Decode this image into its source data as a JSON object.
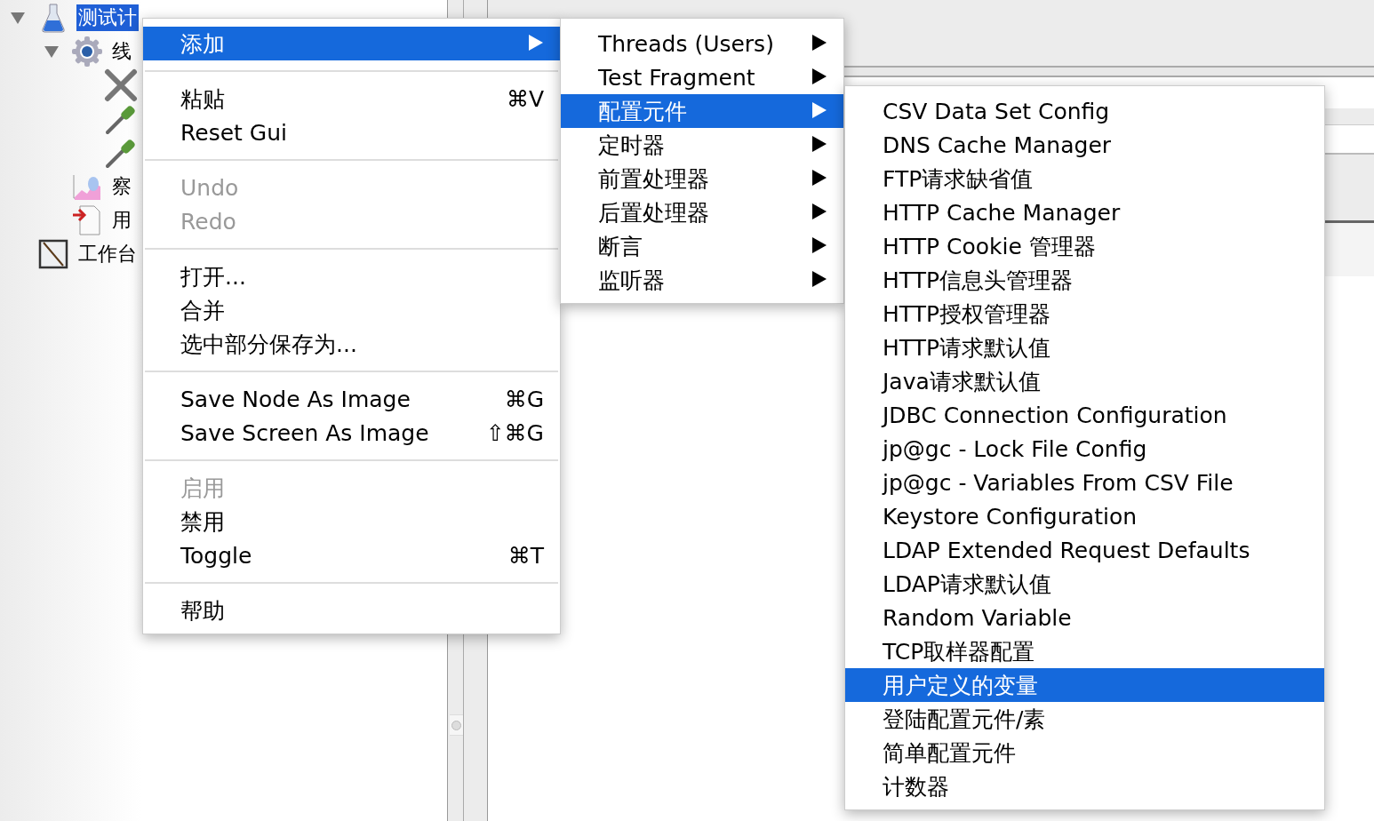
{
  "tree": [
    {
      "label": "测试计",
      "kind": "plan",
      "selected": true,
      "expanded": true,
      "children": [
        {
          "label": "线",
          "kind": "threads",
          "selected": false,
          "expanded": true,
          "children": [
            {
              "kind": "tool"
            },
            {
              "kind": "dropper"
            },
            {
              "kind": "dropper"
            }
          ]
        },
        {
          "label": "察",
          "kind": "graph",
          "selected": false
        },
        {
          "label": "用",
          "kind": "import",
          "selected": false
        }
      ]
    },
    {
      "label": "工作台",
      "kind": "workbench",
      "selected": false
    }
  ],
  "context_menu": {
    "items": [
      {
        "kind": "item",
        "label": "添加",
        "selected": true,
        "disabled": false,
        "submenu": true
      },
      {
        "kind": "separator"
      },
      {
        "kind": "item",
        "label": "粘贴",
        "shortcut": "⌘V",
        "selected": false,
        "disabled": false,
        "submenu": false
      },
      {
        "kind": "item",
        "label": "Reset Gui",
        "selected": false,
        "disabled": false,
        "submenu": false
      },
      {
        "kind": "separator"
      },
      {
        "kind": "item",
        "label": "Undo",
        "selected": false,
        "disabled": true,
        "submenu": false
      },
      {
        "kind": "item",
        "label": "Redo",
        "selected": false,
        "disabled": true,
        "submenu": false
      },
      {
        "kind": "separator"
      },
      {
        "kind": "item",
        "label": "打开...",
        "selected": false,
        "disabled": false,
        "submenu": false
      },
      {
        "kind": "item",
        "label": "合并",
        "selected": false,
        "disabled": false,
        "submenu": false
      },
      {
        "kind": "item",
        "label": "选中部分保存为...",
        "selected": false,
        "disabled": false,
        "submenu": false
      },
      {
        "kind": "separator"
      },
      {
        "kind": "item",
        "label": "Save Node As Image",
        "shortcut": "⌘G",
        "selected": false,
        "disabled": false,
        "submenu": false
      },
      {
        "kind": "item",
        "label": "Save Screen As Image",
        "shortcut": "⇧⌘G",
        "selected": false,
        "disabled": false,
        "submenu": false
      },
      {
        "kind": "separator"
      },
      {
        "kind": "item",
        "label": "启用",
        "selected": false,
        "disabled": true,
        "submenu": false
      },
      {
        "kind": "item",
        "label": "禁用",
        "selected": false,
        "disabled": false,
        "submenu": false
      },
      {
        "kind": "item",
        "label": "Toggle",
        "shortcut": "⌘T",
        "selected": false,
        "disabled": false,
        "submenu": false
      },
      {
        "kind": "separator"
      },
      {
        "kind": "item",
        "label": "帮助",
        "selected": false,
        "disabled": false,
        "submenu": false
      }
    ]
  },
  "add_submenu": {
    "items": [
      {
        "kind": "item",
        "label": "Threads (Users)",
        "selected": false,
        "disabled": false,
        "submenu": true
      },
      {
        "kind": "item",
        "label": "Test Fragment",
        "selected": false,
        "disabled": false,
        "submenu": true
      },
      {
        "kind": "item",
        "label": "配置元件",
        "selected": true,
        "disabled": false,
        "submenu": true
      },
      {
        "kind": "item",
        "label": "定时器",
        "selected": false,
        "disabled": false,
        "submenu": true
      },
      {
        "kind": "item",
        "label": "前置处理器",
        "selected": false,
        "disabled": false,
        "submenu": true
      },
      {
        "kind": "item",
        "label": "后置处理器",
        "selected": false,
        "disabled": false,
        "submenu": true
      },
      {
        "kind": "item",
        "label": "断言",
        "selected": false,
        "disabled": false,
        "submenu": true
      },
      {
        "kind": "item",
        "label": "监听器",
        "selected": false,
        "disabled": false,
        "submenu": true
      }
    ]
  },
  "config_submenu": {
    "items": [
      {
        "kind": "item",
        "label": "CSV Data Set Config",
        "selected": false,
        "disabled": false,
        "submenu": false
      },
      {
        "kind": "item",
        "label": "DNS Cache Manager",
        "selected": false,
        "disabled": false,
        "submenu": false
      },
      {
        "kind": "item",
        "label": "FTP请求缺省值",
        "selected": false,
        "disabled": false,
        "submenu": false
      },
      {
        "kind": "item",
        "label": "HTTP Cache Manager",
        "selected": false,
        "disabled": false,
        "submenu": false
      },
      {
        "kind": "item",
        "label": "HTTP Cookie 管理器",
        "selected": false,
        "disabled": false,
        "submenu": false
      },
      {
        "kind": "item",
        "label": "HTTP信息头管理器",
        "selected": false,
        "disabled": false,
        "submenu": false
      },
      {
        "kind": "item",
        "label": "HTTP授权管理器",
        "selected": false,
        "disabled": false,
        "submenu": false
      },
      {
        "kind": "item",
        "label": "HTTP请求默认值",
        "selected": false,
        "disabled": false,
        "submenu": false
      },
      {
        "kind": "item",
        "label": "Java请求默认值",
        "selected": false,
        "disabled": false,
        "submenu": false
      },
      {
        "kind": "item",
        "label": "JDBC Connection Configuration",
        "selected": false,
        "disabled": false,
        "submenu": false
      },
      {
        "kind": "item",
        "label": "jp@gc - Lock File Config",
        "selected": false,
        "disabled": false,
        "submenu": false
      },
      {
        "kind": "item",
        "label": "jp@gc - Variables From CSV File",
        "selected": false,
        "disabled": false,
        "submenu": false
      },
      {
        "kind": "item",
        "label": "Keystore Configuration",
        "selected": false,
        "disabled": false,
        "submenu": false
      },
      {
        "kind": "item",
        "label": "LDAP Extended Request Defaults",
        "selected": false,
        "disabled": false,
        "submenu": false
      },
      {
        "kind": "item",
        "label": "LDAP请求默认值",
        "selected": false,
        "disabled": false,
        "submenu": false
      },
      {
        "kind": "item",
        "label": "Random Variable",
        "selected": false,
        "disabled": false,
        "submenu": false
      },
      {
        "kind": "item",
        "label": "TCP取样器配置",
        "selected": false,
        "disabled": false,
        "submenu": false
      },
      {
        "kind": "item",
        "label": "用户定义的变量",
        "selected": true,
        "disabled": false,
        "submenu": false
      },
      {
        "kind": "item",
        "label": "登陆配置元件/素",
        "selected": false,
        "disabled": false,
        "submenu": false
      },
      {
        "kind": "item",
        "label": "简单配置元件",
        "selected": false,
        "disabled": false,
        "submenu": false
      },
      {
        "kind": "item",
        "label": "计数器",
        "selected": false,
        "disabled": false,
        "submenu": false
      }
    ]
  }
}
